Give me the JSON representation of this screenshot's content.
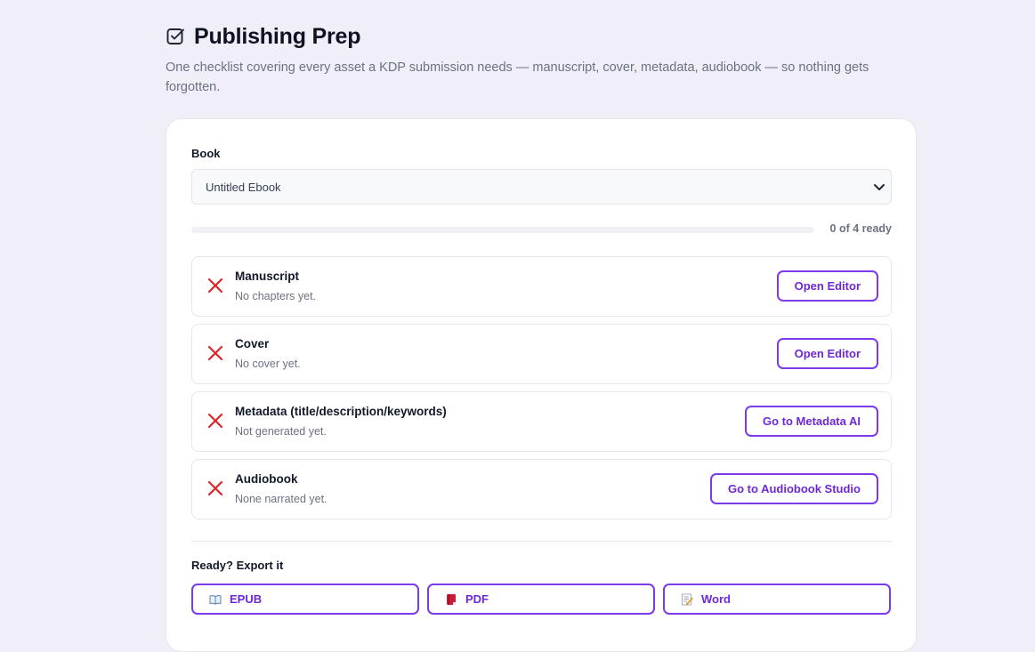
{
  "header": {
    "title": "Publishing Prep",
    "subtitle": "One checklist covering every asset a KDP submission needs — manuscript, cover, metadata, audiobook — so nothing gets forgotten.",
    "icon": "checkbox-icon"
  },
  "book": {
    "label": "Book",
    "selected": "Untitled Ebook"
  },
  "progress": {
    "text": "0 of 4 ready",
    "fraction": 0
  },
  "checklist": [
    {
      "title": "Manuscript",
      "status": "No chapters yet.",
      "action": "Open Editor",
      "done": false
    },
    {
      "title": "Cover",
      "status": "No cover yet.",
      "action": "Open Editor",
      "done": false
    },
    {
      "title": "Metadata (title/description/keywords)",
      "status": "Not generated yet.",
      "action": "Go to Metadata AI",
      "done": false
    },
    {
      "title": "Audiobook",
      "status": "None narrated yet.",
      "action": "Go to Audiobook Studio",
      "done": false
    }
  ],
  "export": {
    "label": "Ready? Export it",
    "buttons": [
      {
        "label": "EPUB",
        "icon": "open-book-icon"
      },
      {
        "label": "PDF",
        "icon": "red-book-icon"
      },
      {
        "label": "Word",
        "icon": "memo-icon"
      }
    ]
  },
  "colors": {
    "accent": "#7c3aed",
    "fail": "#dc2626",
    "background": "#f0eff8"
  }
}
